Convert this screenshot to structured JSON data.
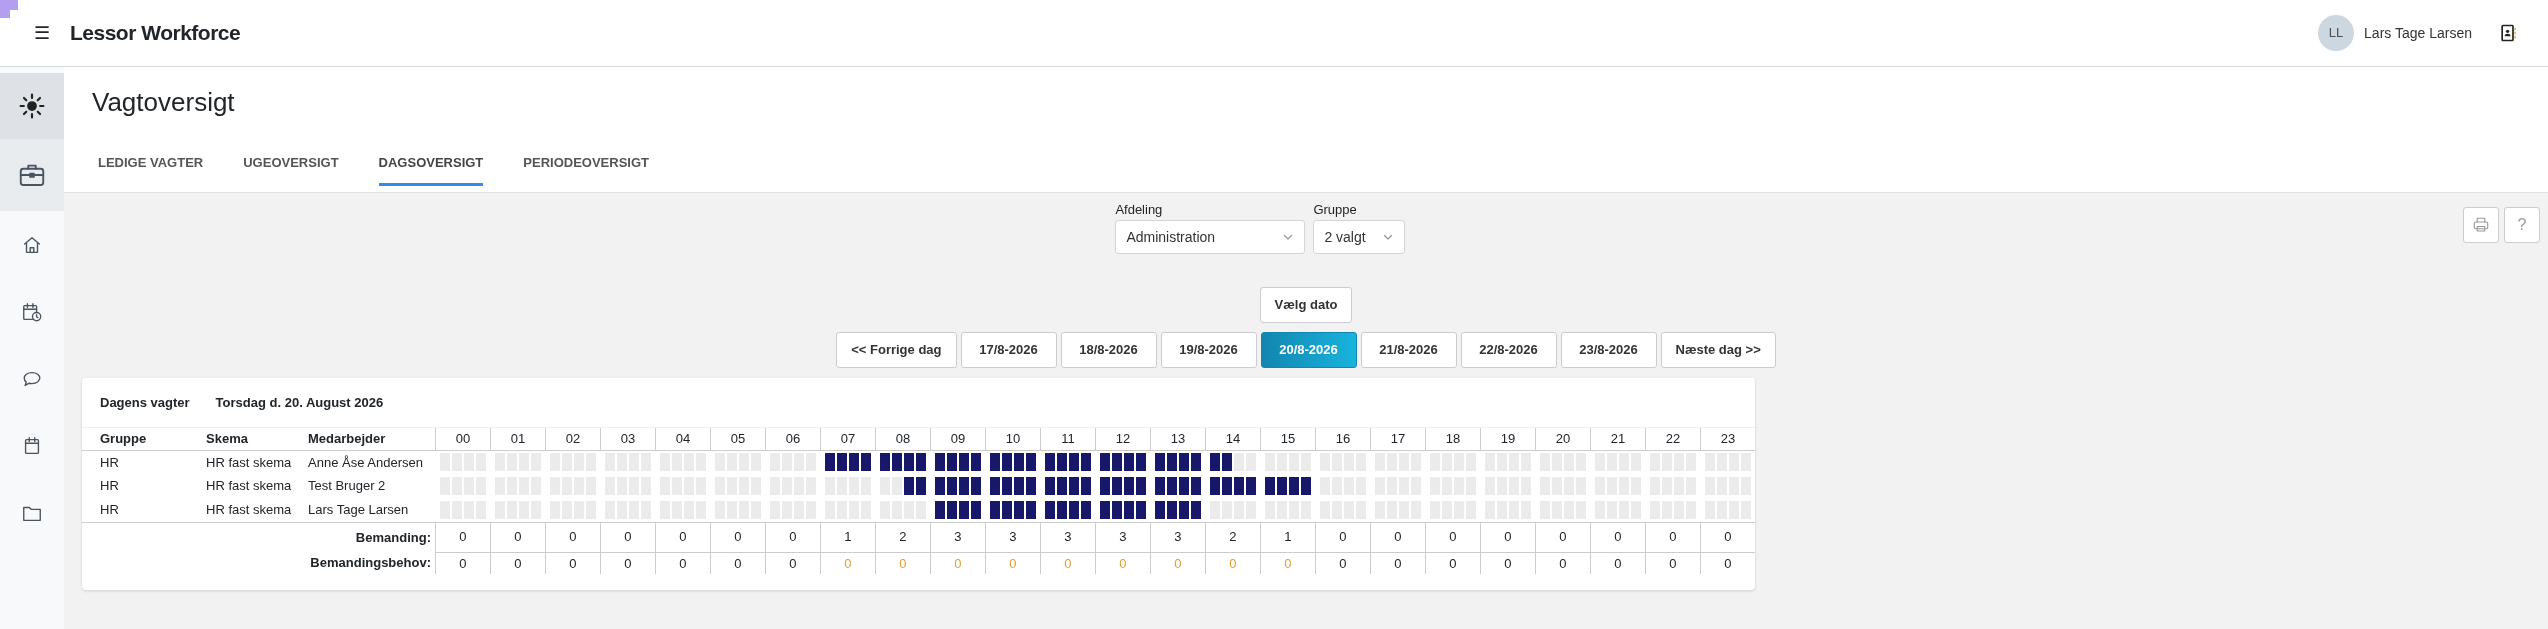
{
  "header": {
    "menu_icon": "☰",
    "brand": "Lessor Workforce",
    "user": {
      "initials": "LL",
      "name": "Lars Tage Larsen"
    }
  },
  "sidebar": {
    "items": [
      {
        "kind": "briefcase",
        "selected": true
      },
      {
        "kind": "home",
        "selected": false
      },
      {
        "kind": "calendar-clock",
        "selected": false
      },
      {
        "kind": "chat",
        "selected": false
      },
      {
        "kind": "calendar",
        "selected": false
      },
      {
        "kind": "folder",
        "selected": false
      }
    ]
  },
  "page": {
    "title": "Vagtoversigt"
  },
  "tabs": [
    {
      "label": "LEDIGE VAGTER",
      "selected": false
    },
    {
      "label": "UGEOVERSIGT",
      "selected": false
    },
    {
      "label": "DAGSOVERSIGT",
      "selected": true
    },
    {
      "label": "PERIODEOVERSIGT",
      "selected": false
    }
  ],
  "filters": [
    {
      "label": "Afdeling",
      "value": "Administration"
    },
    {
      "label": "Gruppe",
      "value": "2 valgt"
    }
  ],
  "tools": {
    "help": "?"
  },
  "date_picker": {
    "button": "Vælg dato"
  },
  "day_nav": [
    {
      "label": "<< Forrige dag",
      "selected": false
    },
    {
      "label": "17/8-2026",
      "selected": false
    },
    {
      "label": "18/8-2026",
      "selected": false
    },
    {
      "label": "19/8-2026",
      "selected": false
    },
    {
      "label": "20/8-2026",
      "selected": true
    },
    {
      "label": "21/8-2026",
      "selected": false
    },
    {
      "label": "22/8-2026",
      "selected": false
    },
    {
      "label": "23/8-2026",
      "selected": false
    },
    {
      "label": "Næste dag >>",
      "selected": false
    }
  ],
  "schedule": {
    "title": "Dagens vagter",
    "date": "Torsdag d. 20. August 2026",
    "columns": [
      "Gruppe",
      "Skema",
      "Medarbejder"
    ],
    "hours": [
      "00",
      "01",
      "02",
      "03",
      "04",
      "05",
      "06",
      "07",
      "08",
      "09",
      "10",
      "11",
      "12",
      "13",
      "14",
      "15",
      "16",
      "17",
      "18",
      "19",
      "20",
      "21",
      "22",
      "23"
    ],
    "rows": [
      {
        "group": "HR",
        "schema": "HR fast skema",
        "employee": "Anne Åse Andersen",
        "quarters": [
          [
            false,
            false,
            false,
            false
          ],
          [
            false,
            false,
            false,
            false
          ],
          [
            false,
            false,
            false,
            false
          ],
          [
            false,
            false,
            false,
            false
          ],
          [
            false,
            false,
            false,
            false
          ],
          [
            false,
            false,
            false,
            false
          ],
          [
            false,
            false,
            false,
            false
          ],
          [
            true,
            true,
            true,
            true
          ],
          [
            true,
            true,
            true,
            true
          ],
          [
            true,
            true,
            true,
            true
          ],
          [
            true,
            true,
            true,
            true
          ],
          [
            true,
            true,
            true,
            true
          ],
          [
            true,
            true,
            true,
            true
          ],
          [
            true,
            true,
            true,
            true
          ],
          [
            true,
            true,
            false,
            false
          ],
          [
            false,
            false,
            false,
            false
          ],
          [
            false,
            false,
            false,
            false
          ],
          [
            false,
            false,
            false,
            false
          ],
          [
            false,
            false,
            false,
            false
          ],
          [
            false,
            false,
            false,
            false
          ],
          [
            false,
            false,
            false,
            false
          ],
          [
            false,
            false,
            false,
            false
          ],
          [
            false,
            false,
            false,
            false
          ],
          [
            false,
            false,
            false,
            false
          ]
        ]
      },
      {
        "group": "HR",
        "schema": "HR fast skema",
        "employee": "Test Bruger 2",
        "quarters": [
          [
            false,
            false,
            false,
            false
          ],
          [
            false,
            false,
            false,
            false
          ],
          [
            false,
            false,
            false,
            false
          ],
          [
            false,
            false,
            false,
            false
          ],
          [
            false,
            false,
            false,
            false
          ],
          [
            false,
            false,
            false,
            false
          ],
          [
            false,
            false,
            false,
            false
          ],
          [
            false,
            false,
            false,
            false
          ],
          [
            false,
            false,
            true,
            true
          ],
          [
            true,
            true,
            true,
            true
          ],
          [
            true,
            true,
            true,
            true
          ],
          [
            true,
            true,
            true,
            true
          ],
          [
            true,
            true,
            true,
            true
          ],
          [
            true,
            true,
            true,
            true
          ],
          [
            true,
            true,
            true,
            true
          ],
          [
            true,
            true,
            true,
            true
          ],
          [
            false,
            false,
            false,
            false
          ],
          [
            false,
            false,
            false,
            false
          ],
          [
            false,
            false,
            false,
            false
          ],
          [
            false,
            false,
            false,
            false
          ],
          [
            false,
            false,
            false,
            false
          ],
          [
            false,
            false,
            false,
            false
          ],
          [
            false,
            false,
            false,
            false
          ],
          [
            false,
            false,
            false,
            false
          ]
        ]
      },
      {
        "group": "HR",
        "schema": "HR fast skema",
        "employee": "Lars Tage Larsen",
        "quarters": [
          [
            false,
            false,
            false,
            false
          ],
          [
            false,
            false,
            false,
            false
          ],
          [
            false,
            false,
            false,
            false
          ],
          [
            false,
            false,
            false,
            false
          ],
          [
            false,
            false,
            false,
            false
          ],
          [
            false,
            false,
            false,
            false
          ],
          [
            false,
            false,
            false,
            false
          ],
          [
            false,
            false,
            false,
            false
          ],
          [
            false,
            false,
            false,
            false
          ],
          [
            true,
            true,
            true,
            true
          ],
          [
            true,
            true,
            true,
            true
          ],
          [
            true,
            true,
            true,
            true
          ],
          [
            true,
            true,
            true,
            true
          ],
          [
            true,
            true,
            true,
            true
          ],
          [
            false,
            false,
            false,
            false
          ],
          [
            false,
            false,
            false,
            false
          ],
          [
            false,
            false,
            false,
            false
          ],
          [
            false,
            false,
            false,
            false
          ],
          [
            false,
            false,
            false,
            false
          ],
          [
            false,
            false,
            false,
            false
          ],
          [
            false,
            false,
            false,
            false
          ],
          [
            false,
            false,
            false,
            false
          ],
          [
            false,
            false,
            false,
            false
          ],
          [
            false,
            false,
            false,
            false
          ]
        ]
      }
    ],
    "summary": [
      {
        "label": "Bemanding:",
        "values": [
          {
            "text": "0",
            "warning": false
          },
          {
            "text": "0",
            "warning": false
          },
          {
            "text": "0",
            "warning": false
          },
          {
            "text": "0",
            "warning": false
          },
          {
            "text": "0",
            "warning": false
          },
          {
            "text": "0",
            "warning": false
          },
          {
            "text": "0",
            "warning": false
          },
          {
            "text": "1",
            "warning": false
          },
          {
            "text": "2",
            "warning": false
          },
          {
            "text": "3",
            "warning": false
          },
          {
            "text": "3",
            "warning": false
          },
          {
            "text": "3",
            "warning": false
          },
          {
            "text": "3",
            "warning": false
          },
          {
            "text": "3",
            "warning": false
          },
          {
            "text": "2",
            "warning": false
          },
          {
            "text": "1",
            "warning": false
          },
          {
            "text": "0",
            "warning": false
          },
          {
            "text": "0",
            "warning": false
          },
          {
            "text": "0",
            "warning": false
          },
          {
            "text": "0",
            "warning": false
          },
          {
            "text": "0",
            "warning": false
          },
          {
            "text": "0",
            "warning": false
          },
          {
            "text": "0",
            "warning": false
          },
          {
            "text": "0",
            "warning": false
          }
        ]
      },
      {
        "label": "Bemandingsbehov:",
        "values": [
          {
            "text": "0",
            "warning": false
          },
          {
            "text": "0",
            "warning": false
          },
          {
            "text": "0",
            "warning": false
          },
          {
            "text": "0",
            "warning": false
          },
          {
            "text": "0",
            "warning": false
          },
          {
            "text": "0",
            "warning": false
          },
          {
            "text": "0",
            "warning": false
          },
          {
            "text": "0",
            "warning": true
          },
          {
            "text": "0",
            "warning": true
          },
          {
            "text": "0",
            "warning": true
          },
          {
            "text": "0",
            "warning": true
          },
          {
            "text": "0",
            "warning": true
          },
          {
            "text": "0",
            "warning": true
          },
          {
            "text": "0",
            "warning": true
          },
          {
            "text": "0",
            "warning": true
          },
          {
            "text": "0",
            "warning": true
          },
          {
            "text": "0",
            "warning": false
          },
          {
            "text": "0",
            "warning": false
          },
          {
            "text": "0",
            "warning": false
          },
          {
            "text": "0",
            "warning": false
          },
          {
            "text": "0",
            "warning": false
          },
          {
            "text": "0",
            "warning": false
          },
          {
            "text": "0",
            "warning": false
          },
          {
            "text": "0",
            "warning": false
          }
        ]
      }
    ]
  }
}
